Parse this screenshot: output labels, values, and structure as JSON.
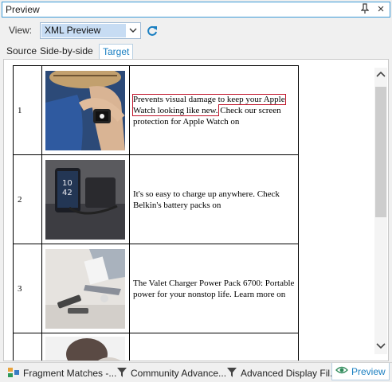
{
  "panel": {
    "title": "Preview"
  },
  "toolbar": {
    "view_label": "View:",
    "view_value": "XML Preview"
  },
  "tabs": [
    {
      "label": "Source",
      "active": false
    },
    {
      "label": "Side-by-side",
      "active": false
    },
    {
      "label": "Target",
      "active": true
    }
  ],
  "rows": [
    {
      "num": "1",
      "image": "watch-photo",
      "text_highlight": "Prevents visual damage to keep your Apple Watch looking like new.",
      "text_rest": " Check our screen protection for Apple Watch on"
    },
    {
      "num": "2",
      "image": "phone-in-pocket-photo",
      "text": "It's so easy to charge up anywhere. Check Belkin's battery packs on"
    },
    {
      "num": "3",
      "image": "power-pack-photo",
      "text": "The Valet Charger Power Pack 6700: Portable power for your nonstop life. Learn more on"
    },
    {
      "num": "",
      "image": "partial-photo",
      "text": ""
    }
  ],
  "bottom_tabs": [
    {
      "label": "Fragment Matches -...",
      "icon": "fragment-matches-icon"
    },
    {
      "label": "Community  Advance...",
      "icon": "filter-icon"
    },
    {
      "label": "Advanced Display Fil...",
      "icon": "filter-icon"
    },
    {
      "label": "Preview",
      "icon": "eye-icon",
      "active": true
    }
  ],
  "colors": {
    "accent": "#1a7fc1",
    "highlight": "#c0142a",
    "selection": "#c7dcf3"
  }
}
